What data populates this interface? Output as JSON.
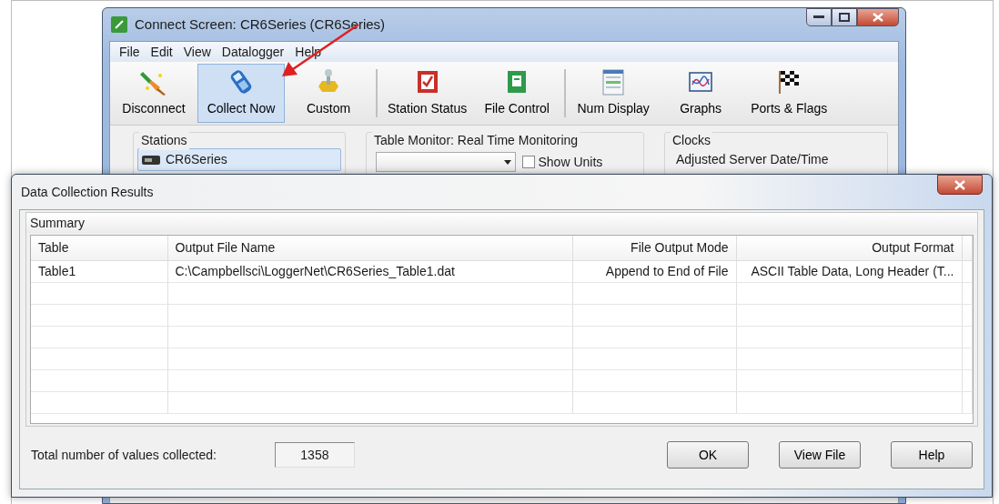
{
  "connect_window": {
    "title": "Connect Screen: CR6Series (CR6Series)",
    "menu": [
      {
        "label": "File"
      },
      {
        "label": "Edit"
      },
      {
        "label": "View"
      },
      {
        "label": "Datalogger"
      },
      {
        "label": "Help"
      }
    ],
    "toolbar": [
      {
        "buttons": [
          {
            "label": "Disconnect",
            "selected": false
          },
          {
            "label": "Collect Now",
            "selected": true
          },
          {
            "label": "Custom",
            "selected": false
          }
        ]
      },
      {
        "buttons": [
          {
            "label": "Station Status",
            "selected": false
          },
          {
            "label": "File Control",
            "selected": false
          }
        ]
      },
      {
        "buttons": [
          {
            "label": "Num Display",
            "selected": false
          },
          {
            "label": "Graphs",
            "selected": false
          },
          {
            "label": "Ports & Flags",
            "selected": false
          }
        ]
      }
    ],
    "stations": {
      "title": "Stations",
      "items": [
        {
          "label": "CR6Series",
          "selected": true
        }
      ]
    },
    "table_monitor": {
      "title": "Table Monitor: Real Time Monitoring",
      "show_units": {
        "label": "Show Units",
        "checked": false
      }
    },
    "clocks": {
      "title": "Clocks",
      "label": "Adjusted Server Date/Time"
    }
  },
  "results_dialog": {
    "title": "Data Collection Results",
    "summary": {
      "title": "Summary",
      "columns": [
        "Table",
        "Output File Name",
        "File Output Mode",
        "Output Format"
      ],
      "rows": [
        [
          "Table1",
          "C:\\Campbellsci\\LoggerNet\\CR6Series_Table1.dat",
          "Append to End of File",
          "ASCII Table Data, Long Header (T..."
        ]
      ]
    },
    "total": {
      "label": "Total number of values collected:",
      "value": "1358"
    },
    "buttons": [
      "OK",
      "View File",
      "Help"
    ]
  }
}
